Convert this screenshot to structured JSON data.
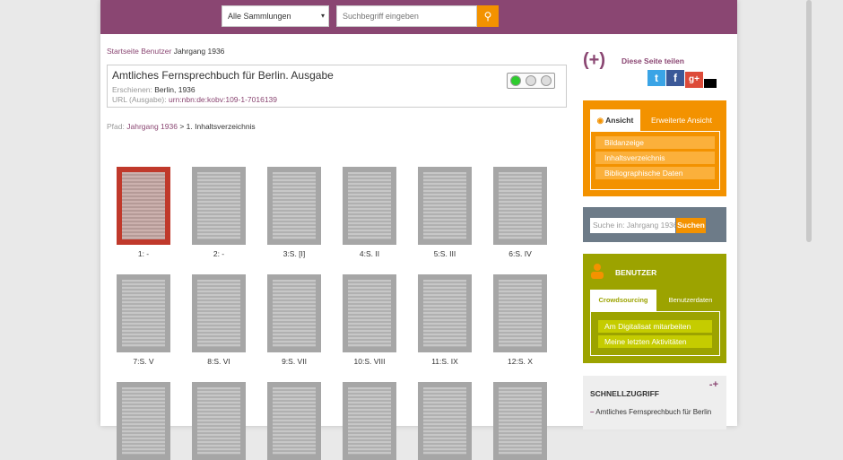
{
  "header": {
    "collection_select": "Alle Sammlungen",
    "search_placeholder": "Suchbegriff eingeben"
  },
  "breadcrumb": {
    "home": "Startseite",
    "user": "Benutzer",
    "current": "Jahrgang 1936"
  },
  "record": {
    "title": "Amtliches Fernsprechbuch für Berlin. Ausgabe",
    "published_label": "Erschienen:",
    "published_value": "Berlin, 1936",
    "url_label": "URL (Ausgabe):",
    "url_value": "urn:nbn:de:kobv:109-1-7016139"
  },
  "path": {
    "label": "Pfad:",
    "link": "Jahrgang 1936",
    "separator": ">",
    "current": "1. Inhaltsverzeichnis"
  },
  "thumbnails": [
    {
      "label": "1: -"
    },
    {
      "label": "2: -"
    },
    {
      "label": "3:S. [I]"
    },
    {
      "label": "4:S. II"
    },
    {
      "label": "5:S. III"
    },
    {
      "label": "6:S. IV"
    },
    {
      "label": "7:S. V"
    },
    {
      "label": "8:S. VI"
    },
    {
      "label": "9:S. VII"
    },
    {
      "label": "10:S. VIII"
    },
    {
      "label": "11:S. IX"
    },
    {
      "label": "12:S. X"
    },
    {
      "label": ""
    },
    {
      "label": ""
    },
    {
      "label": ""
    },
    {
      "label": ""
    },
    {
      "label": ""
    },
    {
      "label": ""
    }
  ],
  "share": {
    "symbol": "(+)",
    "label": "Diese Seite teilen"
  },
  "view": {
    "tab_active": "Ansicht",
    "tab_inactive": "Erweiterte Ansicht",
    "items": [
      "Bildanzeige",
      "Inhaltsverzeichnis",
      "Bibliographische Daten"
    ]
  },
  "inner_search": {
    "placeholder": "Suche in: Jahrgang 1936",
    "button": "Suchen"
  },
  "user": {
    "header": "BENUTZER",
    "tab_active": "Crowdsourcing",
    "tab_inactive": "Benutzerdaten",
    "items": [
      "Am Digitalisat mitarbeiten",
      "Meine letzten Aktivitäten"
    ]
  },
  "quick": {
    "header": "SCHNELLZUGRIFF",
    "toggle": "-+",
    "item_dash": "–",
    "item": "Amtliches Fernsprechbuch für Berlin"
  },
  "colors": {
    "brand": "#8a4672",
    "orange": "#f39200",
    "olive": "#9ca300",
    "slate": "#6d7b88"
  }
}
